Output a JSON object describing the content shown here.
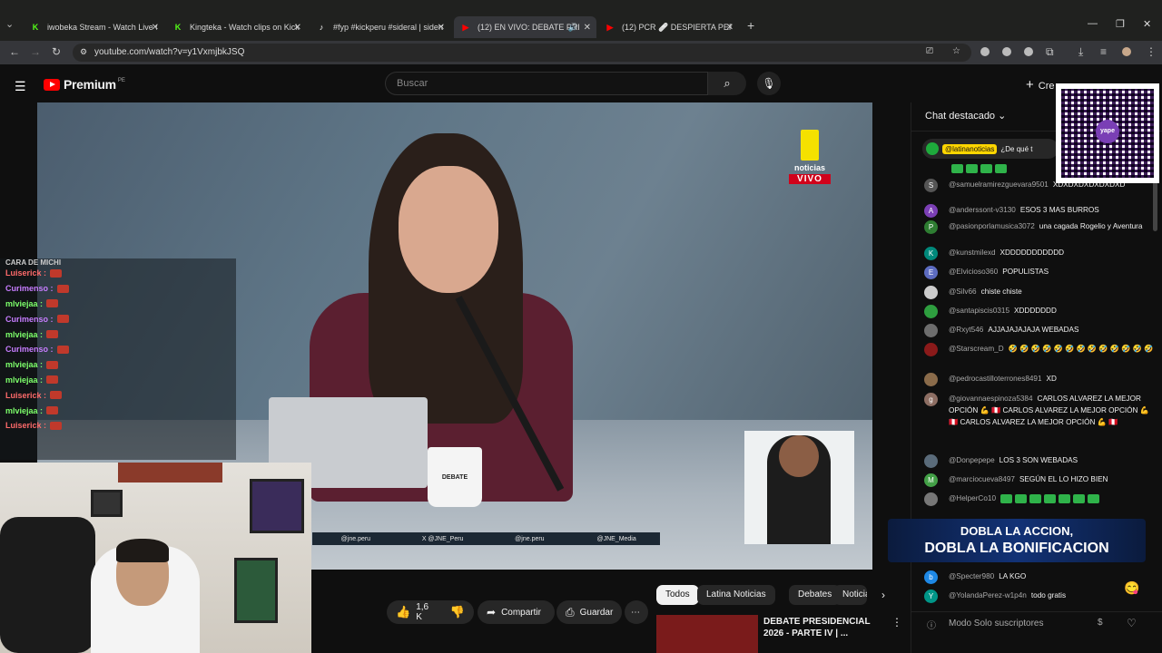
{
  "browser": {
    "tabs": [
      {
        "label": "iwobeka Stream - Watch Live on",
        "fav": "K",
        "fav_color": "#53fc18",
        "active": false
      },
      {
        "label": "Kingteka - Watch clips on Kick",
        "fav": "K",
        "fav_color": "#53fc18",
        "active": false
      },
      {
        "label": "#fyp #kickperu #sideral | sideral",
        "fav": "♪",
        "fav_color": "#111111",
        "active": false
      },
      {
        "label": "(12) EN VIVO: DEBATE PRES",
        "fav": "▶",
        "fav_color": "#ff0000",
        "active": true
      },
      {
        "label": "(12) PCR 🩹 DESPIERTA PERU",
        "fav": "▶",
        "fav_color": "#ff0000",
        "active": false
      }
    ],
    "url": "youtube.com/watch?v=y1VxmjbkJSQ"
  },
  "youtube": {
    "logo_text": "Premium",
    "region": "PE",
    "search_placeholder": "Buscar",
    "create_label": "Cre"
  },
  "video": {
    "channel_logo": "noticias",
    "live_badge": "VIVO",
    "mug_text": "DEBATE",
    "social": [
      "@jne.peru",
      "X @JNE_Peru",
      "@jne.peru",
      "@JNE_Media"
    ]
  },
  "overlay_chat": [
    {
      "user": "Luiserick",
      "color": "#ff6b6b"
    },
    {
      "user": "Curimenso",
      "color": "#c77dff"
    },
    {
      "user": "mlviejaa",
      "color": "#7dff6b"
    },
    {
      "user": "Curimenso",
      "color": "#c77dff"
    },
    {
      "user": "mlviejaa",
      "color": "#7dff6b"
    },
    {
      "user": "Curimenso",
      "color": "#c77dff"
    },
    {
      "user": "mlviejaa",
      "color": "#7dff6b"
    },
    {
      "user": "mlviejaa",
      "color": "#7dff6b"
    },
    {
      "user": "Luiserick",
      "color": "#ff6b6b"
    },
    {
      "user": "mlviejaa",
      "color": "#7dff6b"
    },
    {
      "user": "Luiserick",
      "color": "#ff6b6b"
    }
  ],
  "overlay_top": "CARA DE MICHI",
  "actions": {
    "likes": "1,6 K",
    "share": "Compartir",
    "save": "Guardar"
  },
  "chips": [
    "Todos",
    "Latina Noticias",
    "Debates",
    "Noticias"
  ],
  "recommendation": {
    "title": "DEBATE PRESIDENCIAL 2026 - PARTE IV | ..."
  },
  "chat": {
    "header": "Chat destacado",
    "pinned_author": "@latinanoticias",
    "pinned_text": "¿De qué t",
    "messages": [
      {
        "av": "S",
        "color": "#555555",
        "author": "@samuelramirezguevara9501",
        "text": "XDXDXDXDXDXDXD"
      },
      {
        "av": "A",
        "color": "#7b3fb5",
        "author": "@anderssont-v3130",
        "text": "ESOS 3 MAS BURROS"
      },
      {
        "av": "P",
        "color": "#2e7d32",
        "author": "@pasionporlamusica3072",
        "text": "una cagada Rogelio y Aventura"
      },
      {
        "av": "K",
        "color": "#00897b",
        "author": "@kunstmilexd",
        "text": "XDDDDDDDDDDD"
      },
      {
        "av": "E",
        "color": "#5c6bc0",
        "author": "@Elvicioso360",
        "text": "POPULISTAS"
      },
      {
        "av": "",
        "color": "#cccccc",
        "author": "@Silv66",
        "text": "chiste chiste"
      },
      {
        "av": "",
        "color": "#2e9e3f",
        "author": "@santapiscis0315",
        "text": "XDDDDDDD"
      },
      {
        "av": "",
        "color": "#6d6d6d",
        "author": "@Rxyt546",
        "text": "AJJAJAJAJAJA WEBADAS"
      },
      {
        "av": "",
        "color": "#8b1a1a",
        "author": "@Starscream_D",
        "text": "🤣 🤣 🤣 🤣 🤣 🤣 🤣 🤣 🤣 🤣 🤣 🤣 🤣"
      },
      {
        "av": "",
        "color": "#8a6b4a",
        "author": "@pedrocastilloterrones8491",
        "text": "XD"
      },
      {
        "av": "g",
        "color": "#8d6e63",
        "author": "@giovannaespinoza5384",
        "text": "CARLOS ALVAREZ LA MEJOR OPCIÓN 💪 🇵🇪 CARLOS ALVAREZ LA MEJOR OPCIÓN 💪 🇵🇪 CARLOS ALVAREZ LA MEJOR OPCIÓN 💪 🇵🇪"
      },
      {
        "av": "",
        "color": "#5a6b7a",
        "author": "@Donpepepe",
        "text": "LOS 3 SON WEBADAS"
      },
      {
        "av": "M",
        "color": "#43a047",
        "author": "@marciocueva8497",
        "text": "SEGÚN EL LO HIZO BIEN"
      },
      {
        "av": "",
        "color": "#777777",
        "author": "@HelperCo10",
        "text": ""
      },
      {
        "av": "b",
        "color": "#1e88e5",
        "author": "@Specter980",
        "text": "LA KGO"
      },
      {
        "av": "Y",
        "color": "#009688",
        "author": "@YolandaPerez-w1p4n",
        "text": "todo gratis"
      }
    ],
    "footer": "Modo Solo suscriptores"
  },
  "promo": {
    "line1": "DOBLA LA ACCION,",
    "line2": "DOBLA LA BONIFICACION"
  },
  "qr_label": "yape"
}
